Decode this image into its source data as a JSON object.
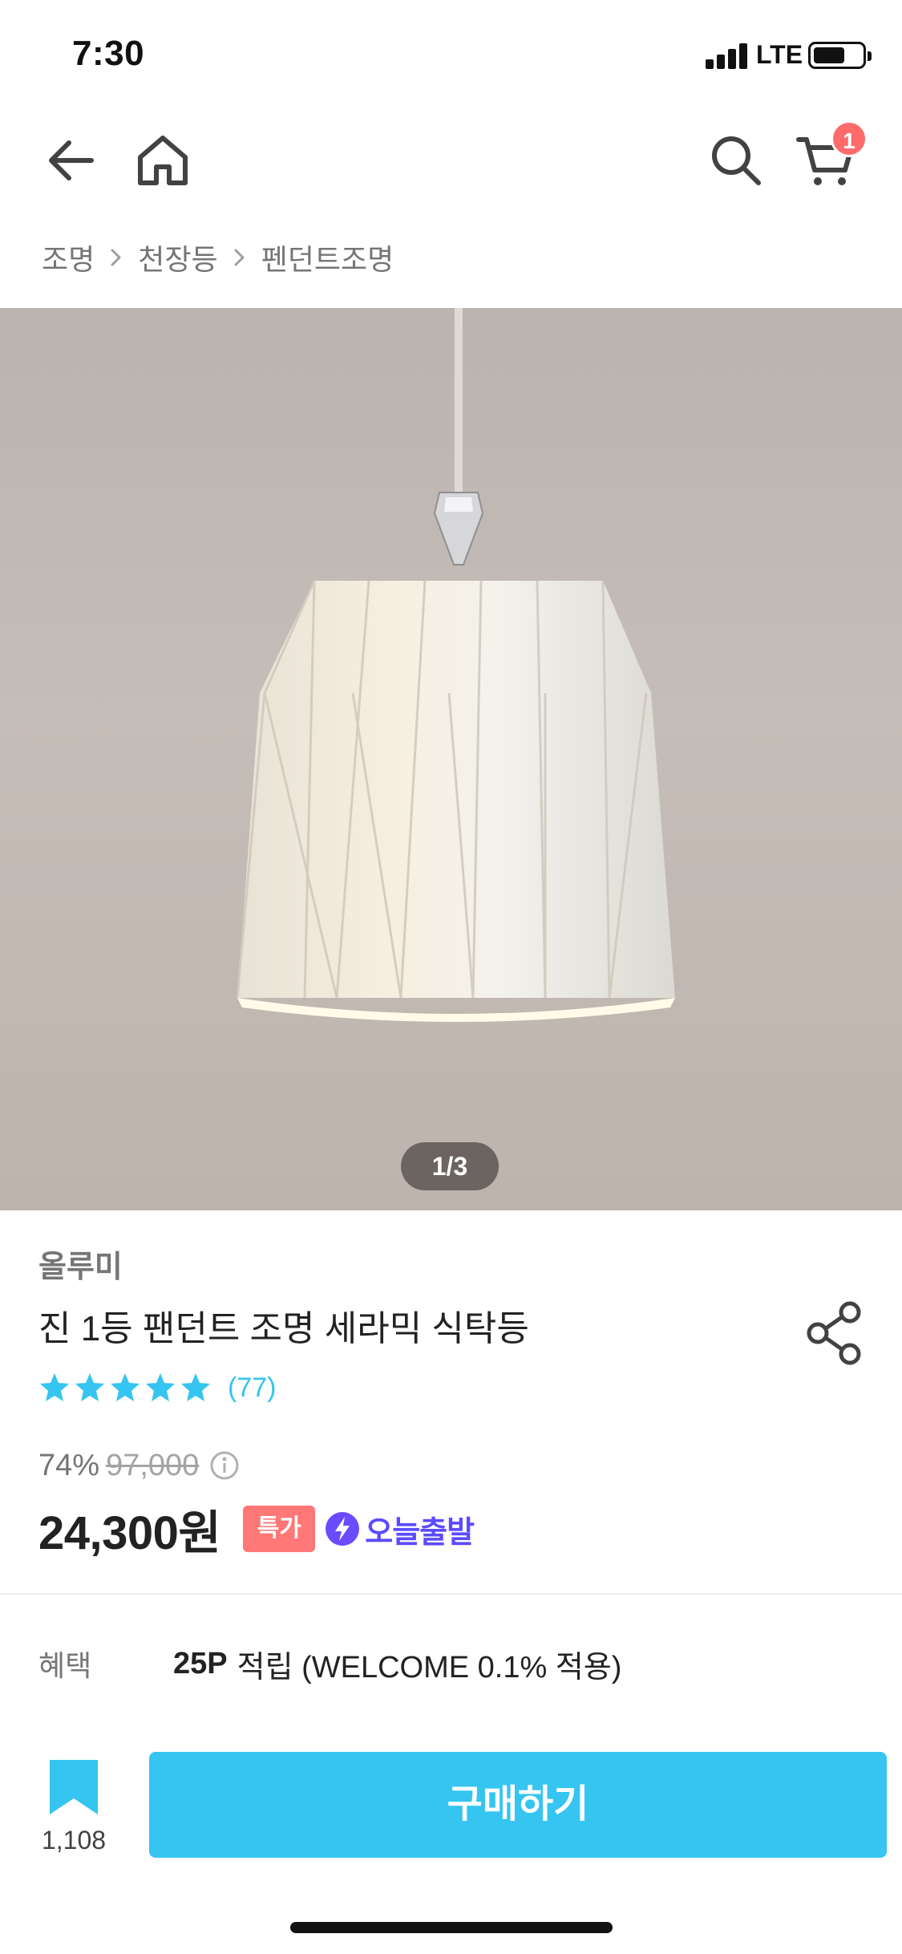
{
  "status_bar": {
    "time": "7:30",
    "network": "LTE",
    "battery_level": 0.6
  },
  "nav": {
    "icons": [
      "back-icon",
      "home-icon",
      "search-icon",
      "cart-icon"
    ],
    "cart_count": "1"
  },
  "breadcrumb": [
    "조명",
    "천장등",
    "펜던트조명"
  ],
  "image": {
    "counter": "1/3"
  },
  "product": {
    "brand": "올루미",
    "title": "진 1등 팬던트 조명 세라믹 식탁등",
    "rating": 5,
    "review_count": "(77)",
    "discount": "74%",
    "original_price": "97,000",
    "sale_price": "24,300원",
    "badge_special": "특가",
    "badge_delivery": "오늘출발"
  },
  "benefit": {
    "label": "혜택",
    "points": "25P",
    "text": "적립 (WELCOME 0.1% 적용)"
  },
  "bottom_bar": {
    "bookmark_count": "1,108",
    "buy_label": "구매하기"
  },
  "colors": {
    "accent": "#35c5f0",
    "badge_red": "#ff7777",
    "delivery_purple": "#5b4bff"
  }
}
